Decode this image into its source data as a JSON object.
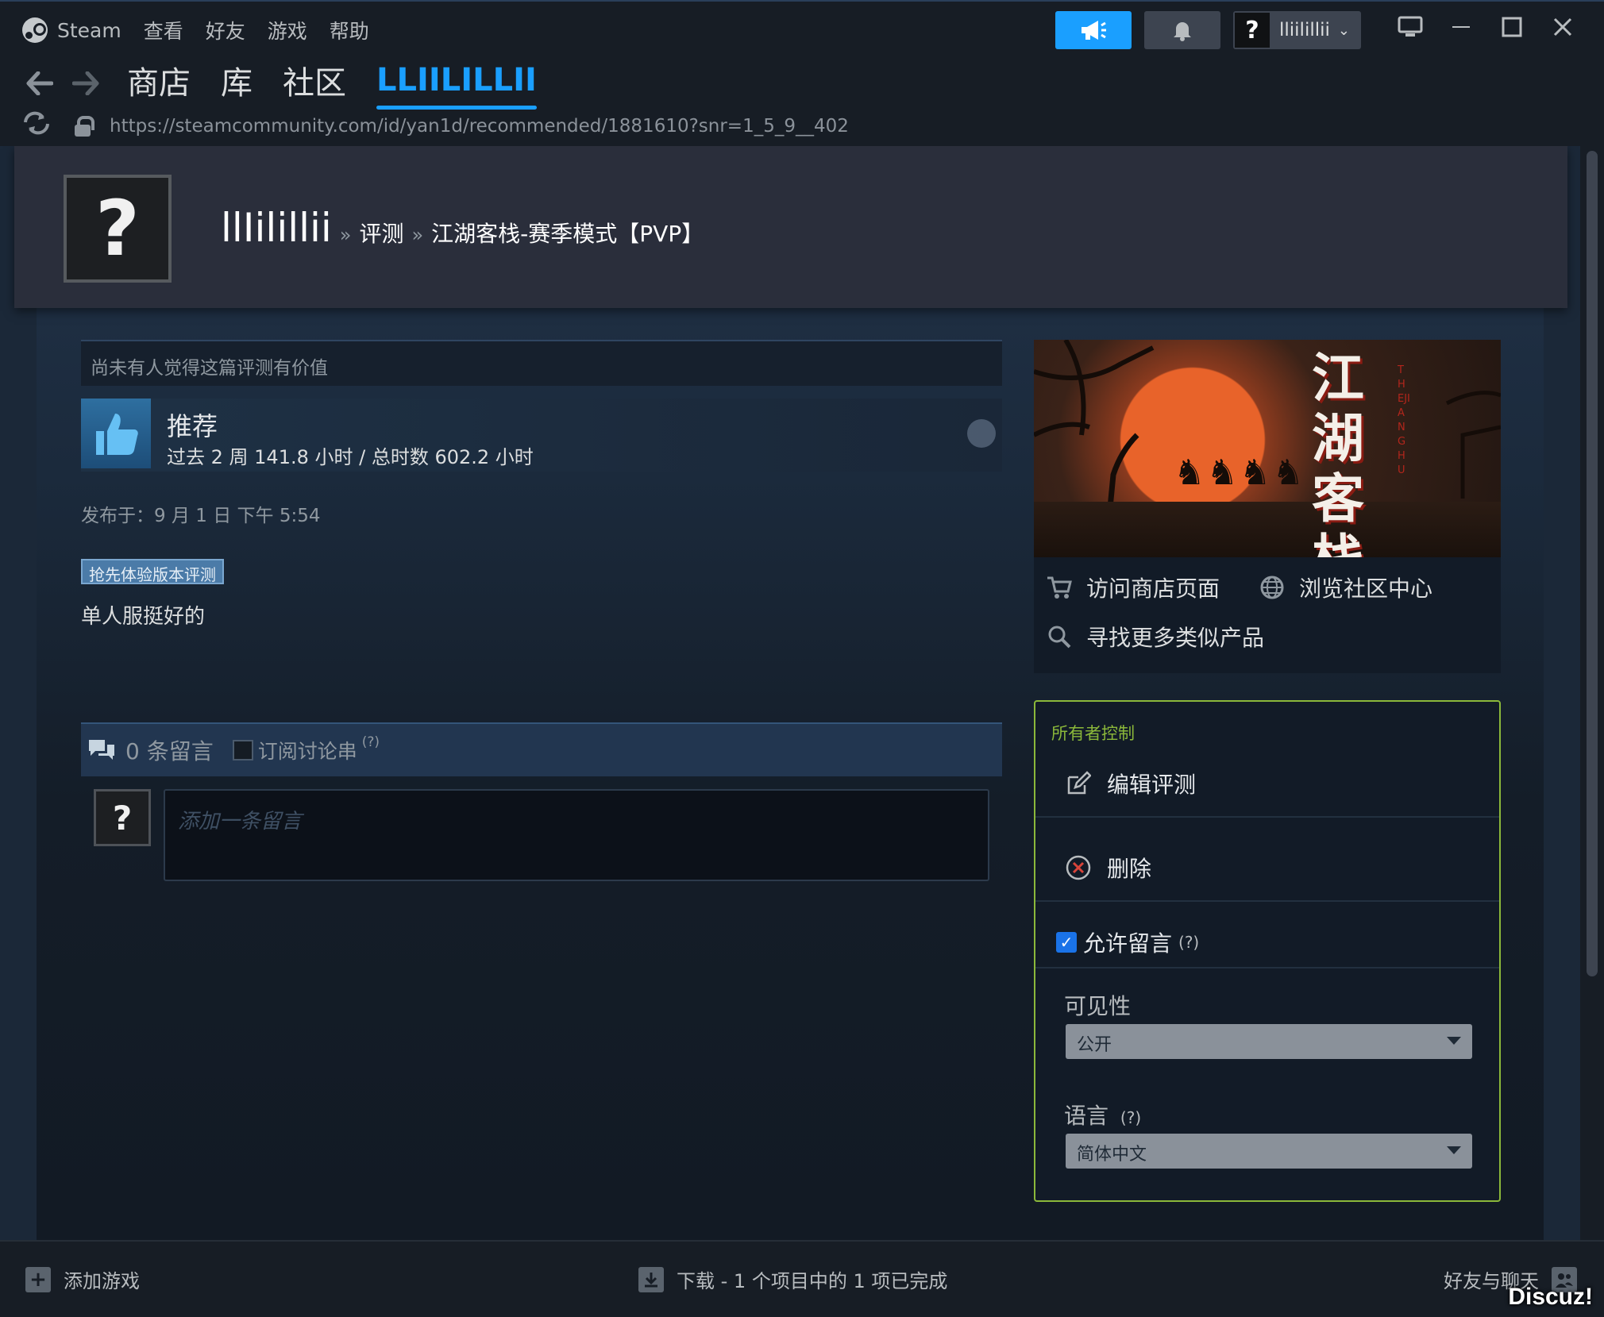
{
  "menu": {
    "app_name": "Steam",
    "items": [
      "查看",
      "好友",
      "游戏",
      "帮助"
    ]
  },
  "nav": {
    "tabs": [
      "商店",
      "库",
      "社区"
    ],
    "active_tab": "LLIILILLII"
  },
  "url": "https://steamcommunity.com/id/yan1d/recommended/1881610?snr=1_5_9__402",
  "account": {
    "avatar_glyph": "?",
    "name": "lliilillii",
    "chevron": "⌄"
  },
  "profile": {
    "avatar_glyph": "?",
    "name": "llIilillii",
    "crumb_sep": "»",
    "crumb_review": "评测",
    "crumb_game": "江湖客栈-赛季模式【PVP】"
  },
  "review": {
    "helpful_text": "尚未有人觉得这篇评测有价值",
    "verdict": "推荐",
    "hours": "过去 2 周 141.8 小时 / 总时数 602.2 小时",
    "posted": "发布于：9 月 1 日 下午 5:54",
    "ea_badge": "抢先体验版本评测",
    "text": "单人服挺好的"
  },
  "comments": {
    "count_label": "0 条留言",
    "subscribe_label": "订阅讨论串",
    "help_mark": "(?)",
    "avatar_glyph": "?",
    "placeholder": "添加一条留言"
  },
  "game": {
    "art_title": "江湖客栈",
    "art_roman": "THEJIANGHU",
    "links": {
      "store": "访问商店页面",
      "community": "浏览社区中心",
      "similar": "寻找更多类似产品"
    }
  },
  "owner": {
    "title": "所有者控制",
    "edit": "编辑评测",
    "delete": "删除",
    "allow_comments": "允许留言",
    "allow_help": "(?)",
    "visibility_label": "可见性",
    "visibility_value": "公开",
    "language_label": "语言",
    "language_help": "(?)",
    "language_value": "简体中文"
  },
  "bottombar": {
    "add_game": "添加游戏",
    "downloads": "下载 - 1 个项目中的 1 项已完成",
    "friends": "好友与聊天",
    "watermark": "Discuz!"
  },
  "colors": {
    "accent": "#1a9fff",
    "owner_border": "#8bb83a",
    "background": "#1b2838"
  }
}
